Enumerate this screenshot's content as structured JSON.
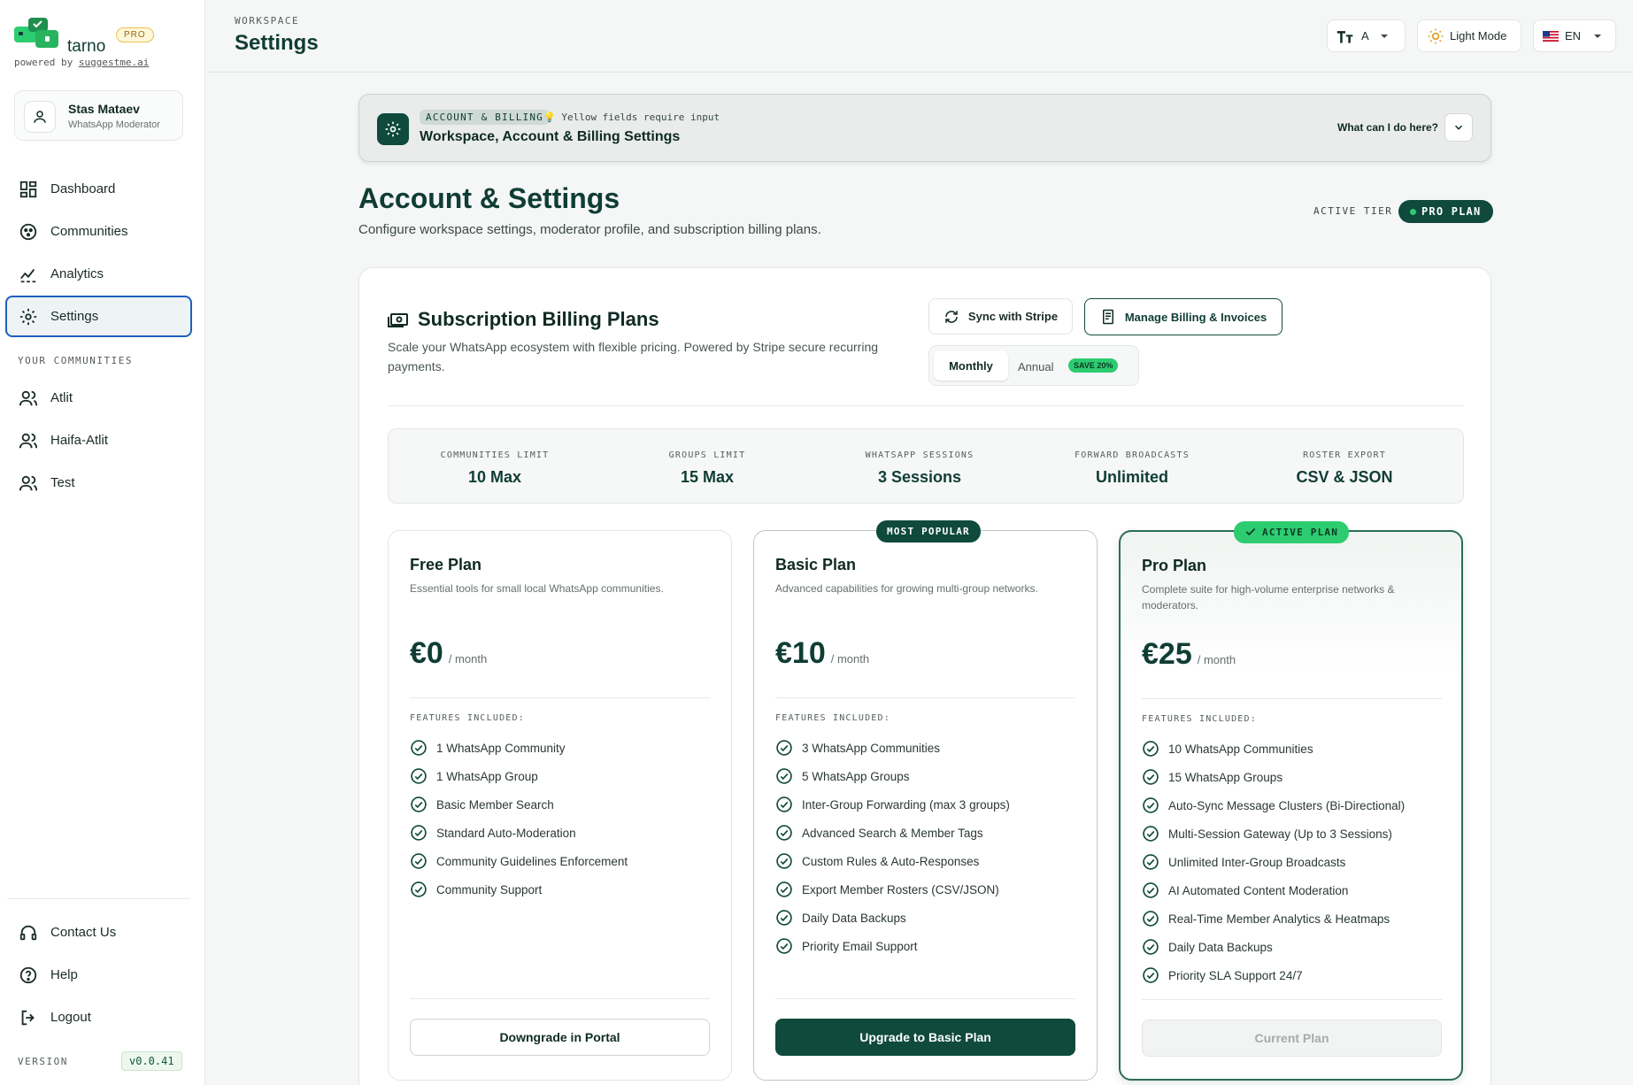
{
  "brand": {
    "name": "tarno",
    "tier_chip": "PRO",
    "powered_prefix": "powered by ",
    "powered_link": "suggestme.ai"
  },
  "user": {
    "name": "Stas Mataev",
    "role": "WhatsApp Moderator"
  },
  "nav": {
    "items": [
      {
        "label": "Dashboard",
        "icon": "dashboard-icon"
      },
      {
        "label": "Communities",
        "icon": "communities-icon"
      },
      {
        "label": "Analytics",
        "icon": "analytics-icon"
      },
      {
        "label": "Settings",
        "icon": "gear-icon",
        "active": true
      }
    ],
    "communities_label": "YOUR COMMUNITIES",
    "communities": [
      {
        "label": "Atlit",
        "icon": "users-icon"
      },
      {
        "label": "Haifa-Atlit",
        "icon": "users-icon"
      },
      {
        "label": "Test",
        "icon": "users-icon"
      }
    ],
    "footer": [
      {
        "label": "Contact Us",
        "icon": "headset-icon"
      },
      {
        "label": "Help",
        "icon": "help-icon"
      },
      {
        "label": "Logout",
        "icon": "logout-icon"
      }
    ],
    "version_label": "VERSION",
    "version": "v0.0.41"
  },
  "topbar": {
    "crumb": "WORKSPACE",
    "title": "Settings",
    "font_size_label": "A",
    "theme_label": "Light Mode",
    "language": "EN"
  },
  "guide": {
    "chip": "ACCOUNT & BILLING",
    "hint": "Yellow fields require input",
    "title": "Workspace, Account & Billing Settings",
    "help": "What can I do here?"
  },
  "header": {
    "title": "Account & Settings",
    "subtitle": "Configure workspace settings, moderator profile, and subscription billing plans.",
    "tier_label": "ACTIVE TIER",
    "tier_value": "PRO PLAN"
  },
  "billing": {
    "title": "Subscription Billing Plans",
    "description": "Scale your WhatsApp ecosystem with flexible pricing. Powered by Stripe secure recurring payments.",
    "sync_label": "Sync with Stripe",
    "manage_label": "Manage Billing & Invoices",
    "cycle_monthly": "Monthly",
    "cycle_annual": "Annual",
    "save_badge": "SAVE 20%",
    "limits": [
      {
        "label": "COMMUNITIES LIMIT",
        "value": "10 Max"
      },
      {
        "label": "GROUPS LIMIT",
        "value": "15 Max"
      },
      {
        "label": "WHATSAPP SESSIONS",
        "value": "3 Sessions"
      },
      {
        "label": "FORWARD BROADCASTS",
        "value": "Unlimited"
      },
      {
        "label": "ROSTER EXPORT",
        "value": "CSV & JSON"
      }
    ],
    "features_label": "FEATURES INCLUDED:",
    "plans": [
      {
        "name": "Free Plan",
        "description": "Essential tools for small local WhatsApp communities.",
        "price": "€0",
        "unit": "/ month",
        "features": [
          "1 WhatsApp Community",
          "1 WhatsApp Group",
          "Basic Member Search",
          "Standard Auto-Moderation",
          "Community Guidelines Enforcement",
          "Community Support"
        ],
        "button": "Downgrade in Portal"
      },
      {
        "name": "Basic Plan",
        "badge": "MOST POPULAR",
        "description": "Advanced capabilities for growing multi-group networks.",
        "price": "€10",
        "unit": "/ month",
        "features": [
          "3 WhatsApp Communities",
          "5 WhatsApp Groups",
          "Inter-Group Forwarding (max 3 groups)",
          "Advanced Search & Member Tags",
          "Custom Rules & Auto-Responses",
          "Export Member Rosters (CSV/JSON)",
          "Daily Data Backups",
          "Priority Email Support"
        ],
        "button": "Upgrade to Basic Plan"
      },
      {
        "name": "Pro Plan",
        "badge": "ACTIVE PLAN",
        "description": "Complete suite for high-volume enterprise networks & moderators.",
        "price": "€25",
        "unit": "/ month",
        "features": [
          "10 WhatsApp Communities",
          "15 WhatsApp Groups",
          "Auto-Sync Message Clusters (Bi-Directional)",
          "Multi-Session Gateway (Up to 3 Sessions)",
          "Unlimited Inter-Group Broadcasts",
          "AI Automated Content Moderation",
          "Real-Time Member Analytics & Heatmaps",
          "Daily Data Backups",
          "Priority SLA Support 24/7"
        ],
        "button": "Current Plan"
      }
    ]
  },
  "colors": {
    "primary": "#0f4a3c",
    "accent_green": "#2ecc71",
    "active_nav_border": "#1d5fbf",
    "background": "#f5f6f6"
  }
}
